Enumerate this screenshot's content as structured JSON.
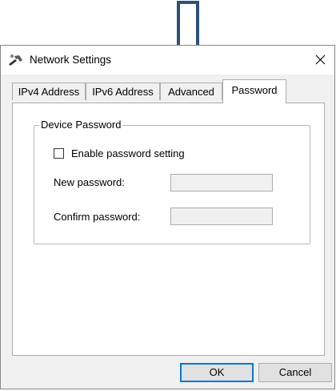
{
  "dialog": {
    "title": "Network Settings",
    "tabs": [
      {
        "label": "IPv4 Address",
        "active": false
      },
      {
        "label": "IPv6 Address",
        "active": false
      },
      {
        "label": "Advanced",
        "active": false
      },
      {
        "label": "Password",
        "active": true
      }
    ],
    "group_title": "Device Password",
    "enable_password_label": "Enable password setting",
    "enable_password_checked": false,
    "new_password_label": "New password:",
    "new_password_value": "",
    "confirm_password_label": "Confirm password:",
    "confirm_password_value": "",
    "ok_label": "OK",
    "cancel_label": "Cancel"
  },
  "colors": {
    "arrow": "#2e5177",
    "dialog_bg": "#f0f0f0",
    "accent": "#0078d7"
  },
  "icons": {
    "app": "tools-icon",
    "close": "close-icon",
    "annotation": "down-arrow-icon"
  }
}
